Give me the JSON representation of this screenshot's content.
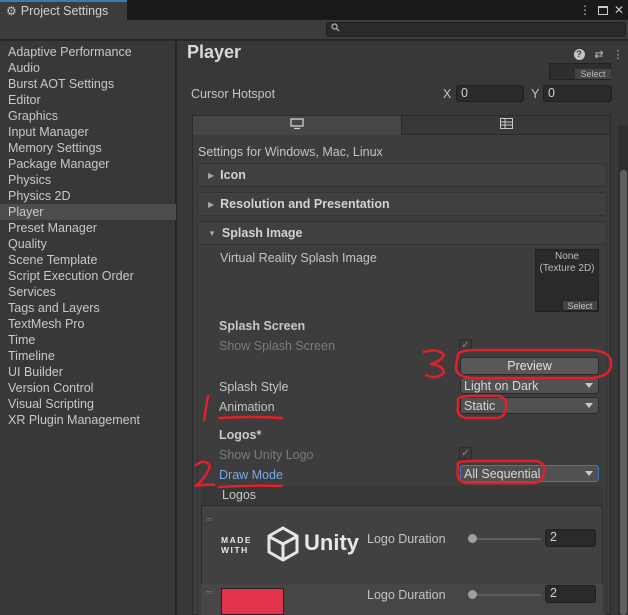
{
  "window": {
    "tab_title": "Project Settings"
  },
  "search": {
    "placeholder": ""
  },
  "sidebar": {
    "items": [
      "Adaptive Performance",
      "Audio",
      "Burst AOT Settings",
      "Editor",
      "Graphics",
      "Input Manager",
      "Memory Settings",
      "Package Manager",
      "Physics",
      "Physics 2D",
      "Player",
      "Preset Manager",
      "Quality",
      "Scene Template",
      "Script Execution Order",
      "Services",
      "Tags and Layers",
      "TextMesh Pro",
      "Time",
      "Timeline",
      "UI Builder",
      "Version Control",
      "Visual Scripting",
      "XR Plugin Management"
    ],
    "selected": "Player"
  },
  "header": {
    "title": "Player",
    "select_label": "Select"
  },
  "cursor": {
    "label": "Cursor Hotspot",
    "x_label": "X",
    "x_value": "0",
    "y_label": "Y",
    "y_value": "0"
  },
  "platform": {
    "settings_label": "Settings for Windows, Mac, Linux"
  },
  "foldouts": {
    "icon": "Icon",
    "resolution": "Resolution and Presentation",
    "splash": "Splash Image"
  },
  "splash": {
    "vr_label": "Virtual Reality Splash Image",
    "vr_thumb_line1": "None",
    "vr_thumb_line2": "(Texture 2D)",
    "vr_select": "Select",
    "screen_header": "Splash Screen",
    "show_splash_label": "Show Splash Screen",
    "preview_label": "Preview",
    "style_label": "Splash Style",
    "style_value": "Light on Dark",
    "animation_label": "Animation",
    "animation_value": "Static",
    "logos_header": "Logos*",
    "show_unity_logo_label": "Show Unity Logo",
    "draw_mode_label": "Draw Mode",
    "draw_mode_value": "All Sequential"
  },
  "logos": {
    "list_header": "Logos",
    "made_with_line1": "MADE",
    "made_with_line2": "WITH",
    "unity_word": "Unity",
    "rows": [
      {
        "duration_label": "Logo Duration",
        "duration_value": "2"
      },
      {
        "duration_label": "Logo Duration",
        "duration_value": "2"
      }
    ]
  },
  "annotations": {
    "one": "1",
    "two": "2",
    "three": "3",
    "color": "#e0202a"
  }
}
